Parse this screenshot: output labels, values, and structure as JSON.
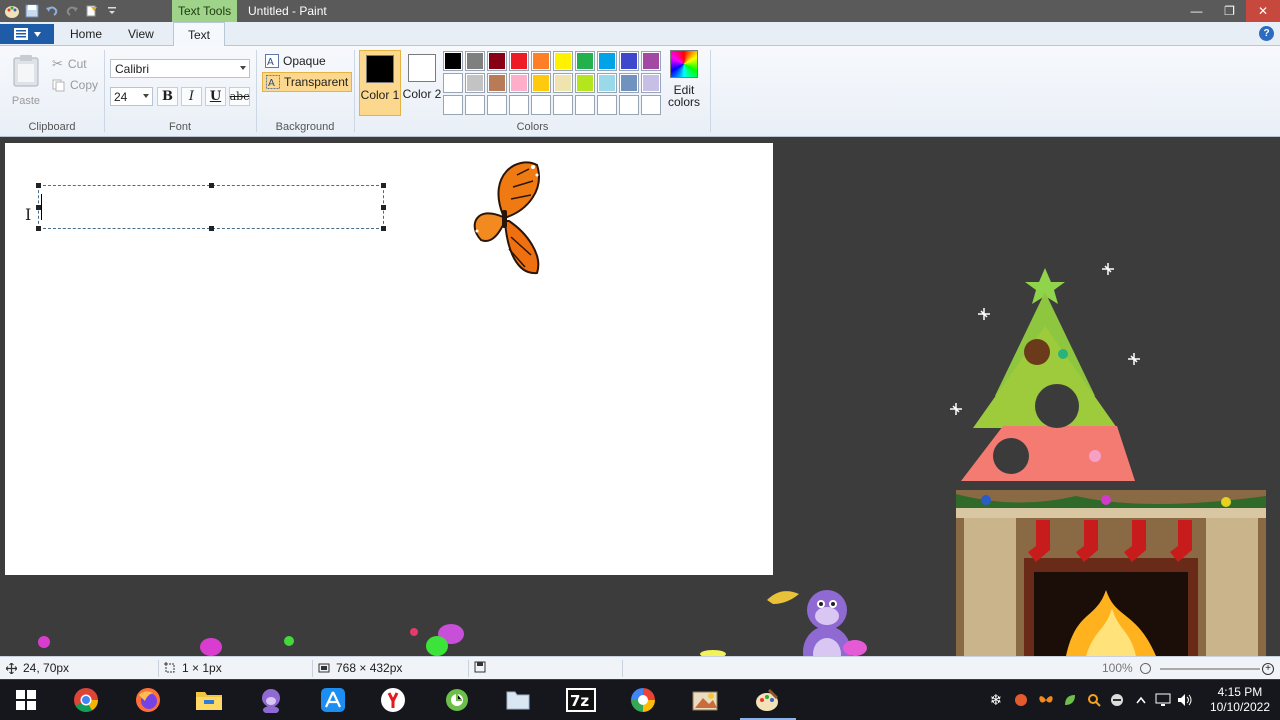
{
  "window": {
    "title": "Untitled - Paint",
    "context_tab": "Text Tools",
    "minimize": "—",
    "restore": "❐",
    "close": "✕"
  },
  "tabs": [
    {
      "label": "Home"
    },
    {
      "label": "View"
    },
    {
      "label": "Text"
    }
  ],
  "help": "?",
  "clipboard": {
    "paste": "Paste",
    "cut": "Cut",
    "copy": "Copy",
    "group": "Clipboard"
  },
  "font": {
    "family": "Calibri",
    "size": "24",
    "bold": "B",
    "italic": "I",
    "underline": "U",
    "strike": "abc",
    "group": "Font"
  },
  "background": {
    "opaque": "Opaque",
    "transparent": "Transparent",
    "group": "Background"
  },
  "colors": {
    "color1_label": "Color 1",
    "color2_label": "Color 2",
    "color1": "#000000",
    "color2": "#ffffff",
    "edit": "Edit colors",
    "group": "Colors",
    "palette": [
      "#000000",
      "#7f7f7f",
      "#880015",
      "#ed1c24",
      "#ff7f27",
      "#fff200",
      "#22b14c",
      "#00a2e8",
      "#3f48cc",
      "#a349a4",
      "#ffffff",
      "#c3c3c3",
      "#b97a57",
      "#ffaec9",
      "#ffc90e",
      "#efe4b0",
      "#b5e61d",
      "#99d9ea",
      "#7092be",
      "#c8bfe7",
      "",
      "",
      "",
      "",
      "",
      "",
      "",
      "",
      "",
      ""
    ]
  },
  "status": {
    "cursor": "24, 70px",
    "selection": "1 × 1px",
    "canvas_size": "768 × 432px",
    "zoom": "100%"
  },
  "taskbar": {
    "time": "4:15 PM",
    "date": "10/10/2022",
    "apps": [
      "start-icon",
      "chrome-icon",
      "firefox-icon",
      "file-explorer-icon",
      "bonzi-buddy-icon",
      "app-store-icon",
      "yandex-icon",
      "greenshot-icon",
      "folder-icon",
      "7zip-icon",
      "colorful-app-icon",
      "image-app-icon",
      "paint-icon"
    ]
  }
}
